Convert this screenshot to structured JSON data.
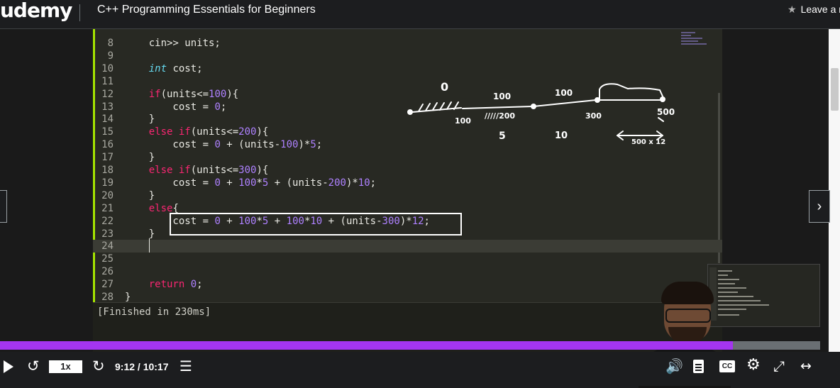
{
  "header": {
    "logo": "udemy",
    "course_title": "C++ Programming Essentials for Beginners",
    "rating_label": "Leave a r"
  },
  "editor": {
    "lines": [
      {
        "n": "8",
        "code": "    cin>> units;"
      },
      {
        "n": "9",
        "code": ""
      },
      {
        "n": "10",
        "code": "    int cost;"
      },
      {
        "n": "11",
        "code": ""
      },
      {
        "n": "12",
        "code": "    if(units<=100){"
      },
      {
        "n": "13",
        "code": "        cost = 0;"
      },
      {
        "n": "14",
        "code": "    }"
      },
      {
        "n": "15",
        "code": "    else if(units<=200){"
      },
      {
        "n": "16",
        "code": "        cost = 0 + (units-100)*5;"
      },
      {
        "n": "17",
        "code": "    }"
      },
      {
        "n": "18",
        "code": "    else if(units<=300){"
      },
      {
        "n": "19",
        "code": "        cost = 0 + 100*5 + (units-200)*10;"
      },
      {
        "n": "20",
        "code": "    }"
      },
      {
        "n": "21",
        "code": "    else{"
      },
      {
        "n": "22",
        "code": "        cost = 0 + 100*5 + 100*10 + (units-300)*12;"
      },
      {
        "n": "23",
        "code": "    }"
      },
      {
        "n": "24",
        "code": ""
      },
      {
        "n": "25",
        "code": ""
      },
      {
        "n": "26",
        "code": ""
      },
      {
        "n": "27",
        "code": "    return 0;"
      },
      {
        "n": "28",
        "code": "}"
      }
    ],
    "active_line": "24",
    "output": "[Finished in 230ms]"
  },
  "annotations": {
    "zero": "0",
    "hundred_top": "100",
    "hundred_top2": "100",
    "hundred_bottom": "100",
    "two_hundred": "/////200",
    "three_hundred": "300",
    "five_hundred": "500",
    "five": "5",
    "ten": "10",
    "rate_label": "500 x 12"
  },
  "player": {
    "progress_fraction": 0.8939,
    "playback_rate": "1x",
    "time": "9:12 / 10:17",
    "cc_label": "CC"
  },
  "icons": {
    "prev": "chevron-left-icon",
    "next": "chevron-right-icon",
    "play": "play-icon",
    "rewind": "rewind-5-icon",
    "forward": "forward-5-icon",
    "notes": "notes-icon",
    "volume": "volume-icon",
    "transcript": "transcript-icon",
    "captions": "captions-icon",
    "settings": "gear-icon",
    "fullscreen": "fullscreen-icon",
    "expand": "expand-icon"
  }
}
